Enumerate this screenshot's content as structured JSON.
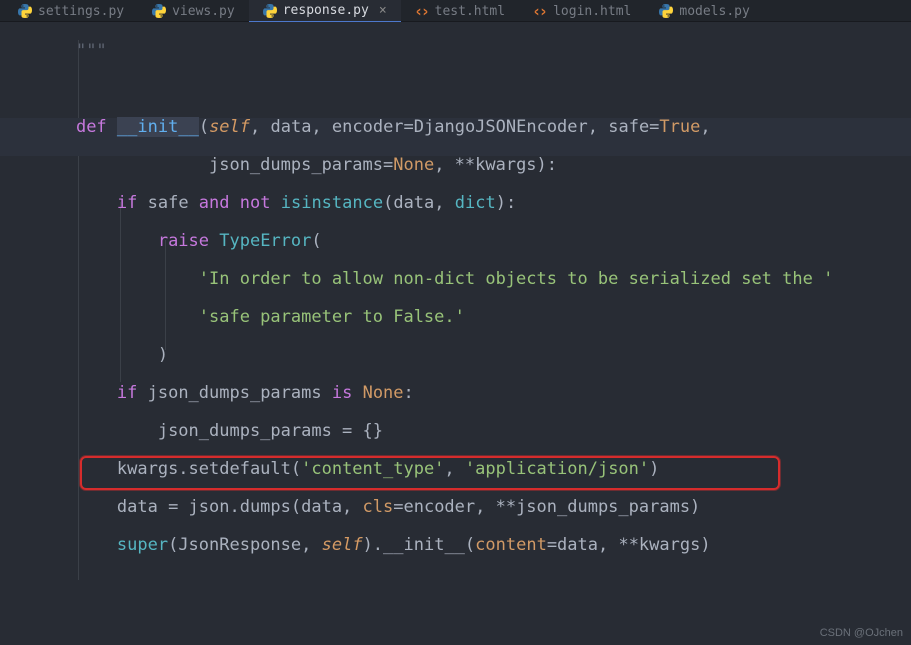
{
  "tabs": [
    {
      "icon": "py",
      "label": "settings.py",
      "active": false
    },
    {
      "icon": "py",
      "label": "views.py",
      "active": false
    },
    {
      "icon": "py",
      "label": "response.py",
      "active": true
    },
    {
      "icon": "html",
      "label": "test.html",
      "active": false
    },
    {
      "icon": "html",
      "label": "login.html",
      "active": false
    },
    {
      "icon": "py",
      "label": "models.py",
      "active": false
    }
  ],
  "close_glyph": "×",
  "code": {
    "l1_docstring": "\"\"\"",
    "l3_def": "def",
    "l3_name": "__init__",
    "l3_self": "self",
    "l3_p": ", data, encoder=DjangoJSONEncoder, safe=",
    "l3_true": "True",
    "l3_end": ",",
    "l4": "                 json_dumps_params=",
    "l4_none": "None",
    "l4_end": ", **kwargs):",
    "l5_if": "if",
    "l5_a": " safe ",
    "l5_and": "and",
    "l5_b": " ",
    "l5_not": "not",
    "l5_c": " ",
    "l5_isin": "isinstance",
    "l5_d": "(data, ",
    "l5_dict": "dict",
    "l5_e": "):",
    "l6_raise": "raise",
    "l6_sp": " ",
    "l6_type": "TypeError",
    "l6_p": "(",
    "l7_str": "'In order to allow non-dict objects to be serialized set the '",
    "l8_str": "'safe parameter to False.'",
    "l9": ")",
    "l10_if": "if",
    "l10_a": " json_dumps_params ",
    "l10_is": "is",
    "l10_sp": " ",
    "l10_none": "None",
    "l10_b": ":",
    "l11": "json_dumps_params = {}",
    "l12_a": "kwargs.setdefault(",
    "l12_s1": "'content_type'",
    "l12_b": ", ",
    "l12_s2": "'application/json'",
    "l12_c": ")",
    "l13_a": "data = json.dumps(data, ",
    "l13_cls": "cls",
    "l13_b": "=encoder, **json_dumps_params)",
    "l14_super": "super",
    "l14_a": "(JsonResponse, ",
    "l14_self": "self",
    "l14_b": ").__init__(",
    "l14_content": "content",
    "l14_c": "=data, **kwargs)"
  },
  "watermark": "CSDN @OJchen"
}
